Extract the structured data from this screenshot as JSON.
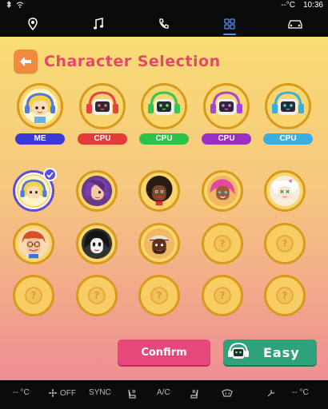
{
  "status": {
    "temp": "--°C",
    "time": "10:36"
  },
  "nav": {
    "items": [
      "location-icon",
      "music-icon",
      "phone-icon",
      "apps-icon",
      "car-icon"
    ],
    "active_index": 3
  },
  "header": {
    "title": "Character Selection"
  },
  "players": [
    {
      "tag": "ME",
      "color": "#3a3ad9"
    },
    {
      "tag": "CPU",
      "color": "#e43a3a"
    },
    {
      "tag": "CPU",
      "color": "#2cc24a"
    },
    {
      "tag": "CPU",
      "color": "#9a2fc5"
    },
    {
      "tag": "CPU",
      "color": "#3aaee0"
    }
  ],
  "grid": {
    "placeholder": "?",
    "rows": [
      [
        "blonde-headphones-selected",
        "purple-hair",
        "afro",
        "pink-hair",
        "white-hair-bow"
      ],
      [
        "red-hair-glasses",
        "black-hair-pale",
        "dark-hat",
        "empty",
        "empty"
      ],
      [
        "empty",
        "empty",
        "empty",
        "empty",
        "empty"
      ]
    ]
  },
  "actions": {
    "confirm_label": "Confirm",
    "difficulty_label": "Easy"
  },
  "climate": {
    "left_temp": "-- °C",
    "fan": "OFF",
    "sync": "SYNC",
    "ac": "A/C",
    "right_temp": "-- °C"
  }
}
